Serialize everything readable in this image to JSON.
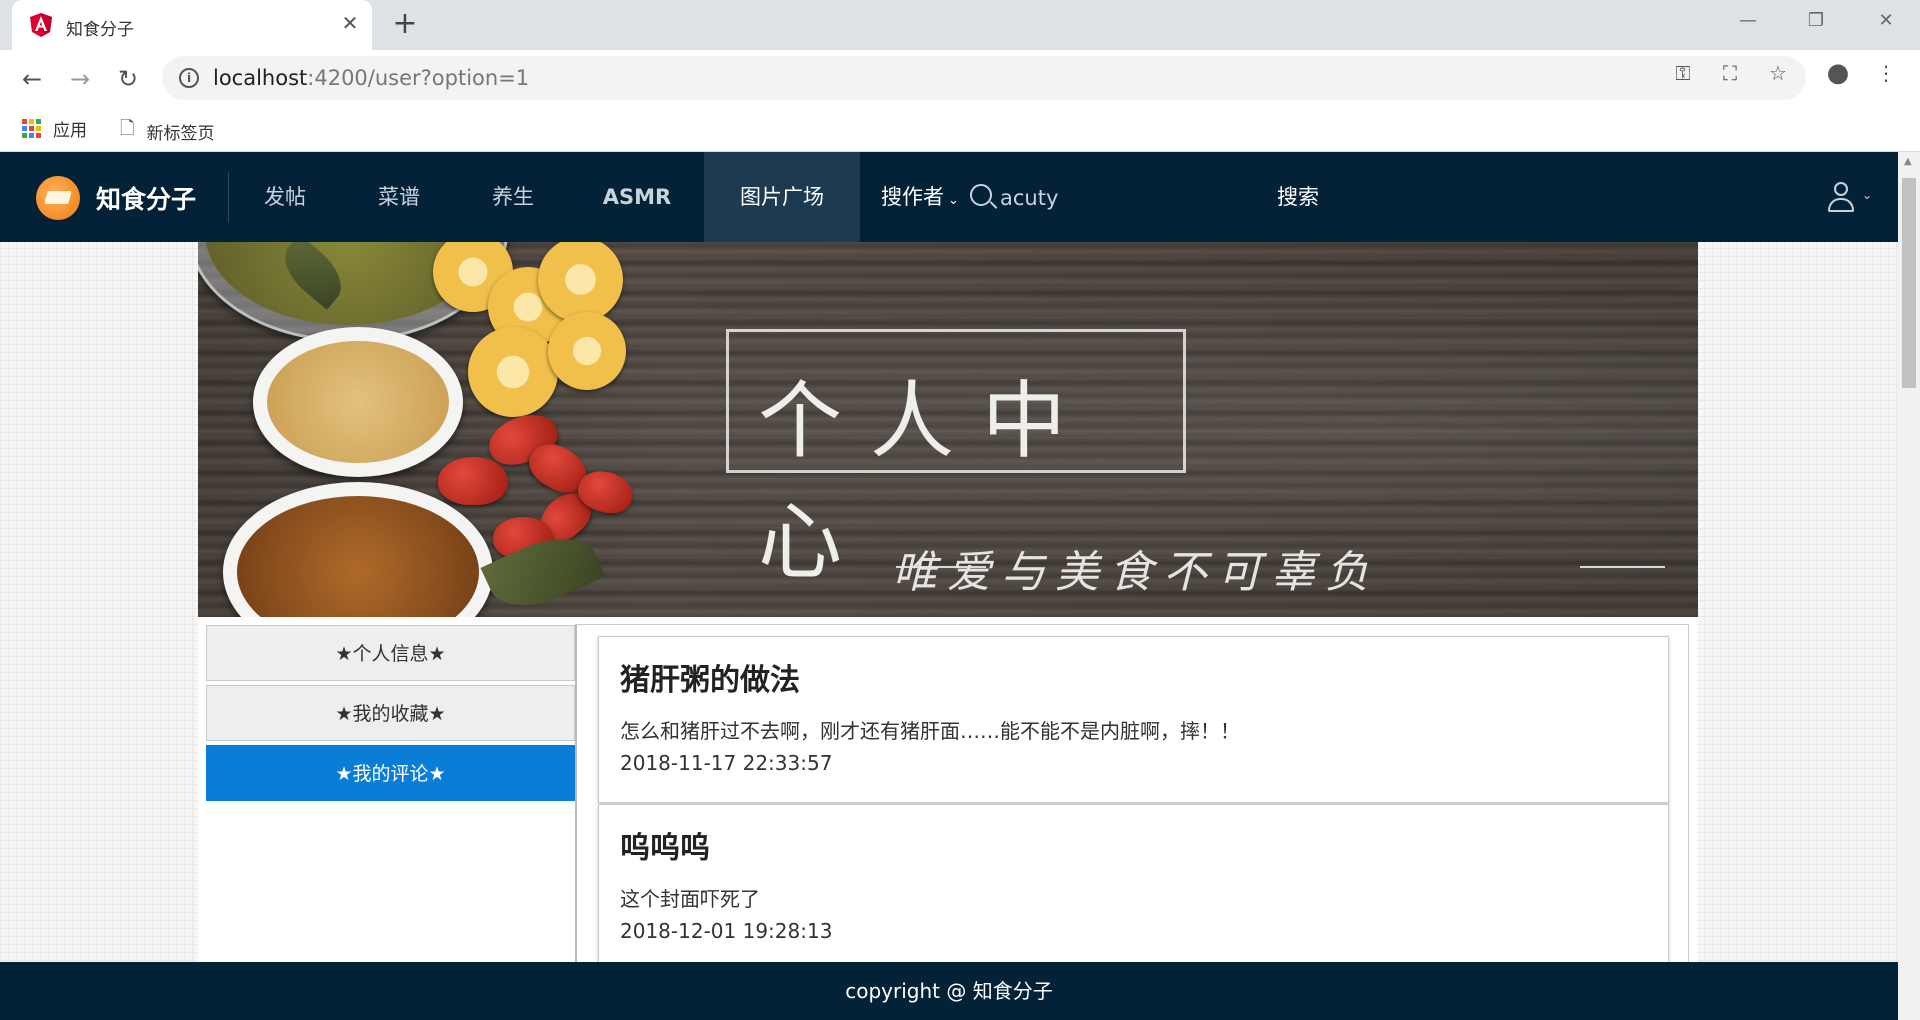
{
  "browser": {
    "tab_title": "知食分子",
    "url_host": "localhost",
    "url_rest": ":4200/user?option=1",
    "bookmarks": [
      "应用",
      "新标签页"
    ]
  },
  "nav": {
    "brand": "知食分子",
    "items": [
      "发帖",
      "菜谱",
      "养生",
      "ASMR",
      "图片广场"
    ],
    "active_item": "图片广场",
    "author_dropdown": "搜作者",
    "search_value": "acuty",
    "search_button": "搜索"
  },
  "banner": {
    "title": "个人中心",
    "subtitle": "唯爱与美食不可辜负"
  },
  "sidebar": {
    "tabs": [
      "★个人信息★",
      "★我的收藏★",
      "★我的评论★"
    ],
    "active": "★我的评论★"
  },
  "comments": [
    {
      "title": "猪肝粥的做法",
      "text": "怎么和猪肝过不去啊，刚才还有猪肝面……能不能不是内脏啊，摔！！",
      "time": "2018-11-17 22:33:57"
    },
    {
      "title": "呜呜呜",
      "text": "这个封面吓死了",
      "time": "2018-12-01 19:28:13"
    }
  ],
  "footer": {
    "text": "copyright @ 知食分子"
  },
  "colors": {
    "navbar": "#032137",
    "active_tab": "#0a7ed6",
    "angular_red": "#dd0031"
  }
}
